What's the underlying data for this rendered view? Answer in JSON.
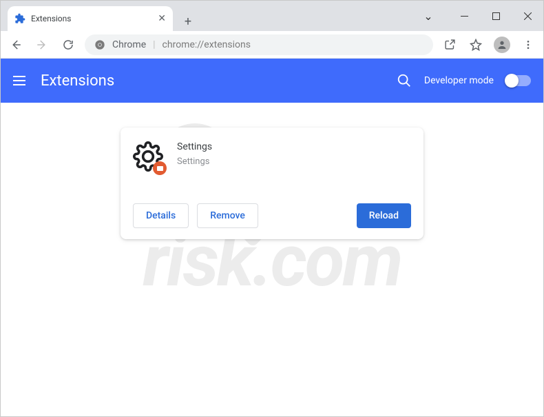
{
  "window": {
    "tab_title": "Extensions"
  },
  "addressbar": {
    "prefix": "Chrome",
    "url": "chrome://extensions"
  },
  "header": {
    "title": "Extensions",
    "developer_mode_label": "Developer mode"
  },
  "extension_card": {
    "name": "Settings",
    "subtitle": "Settings",
    "buttons": {
      "details": "Details",
      "remove": "Remove",
      "reload": "Reload"
    }
  },
  "watermark": {
    "top": "PC",
    "bottom": "risk.com"
  }
}
